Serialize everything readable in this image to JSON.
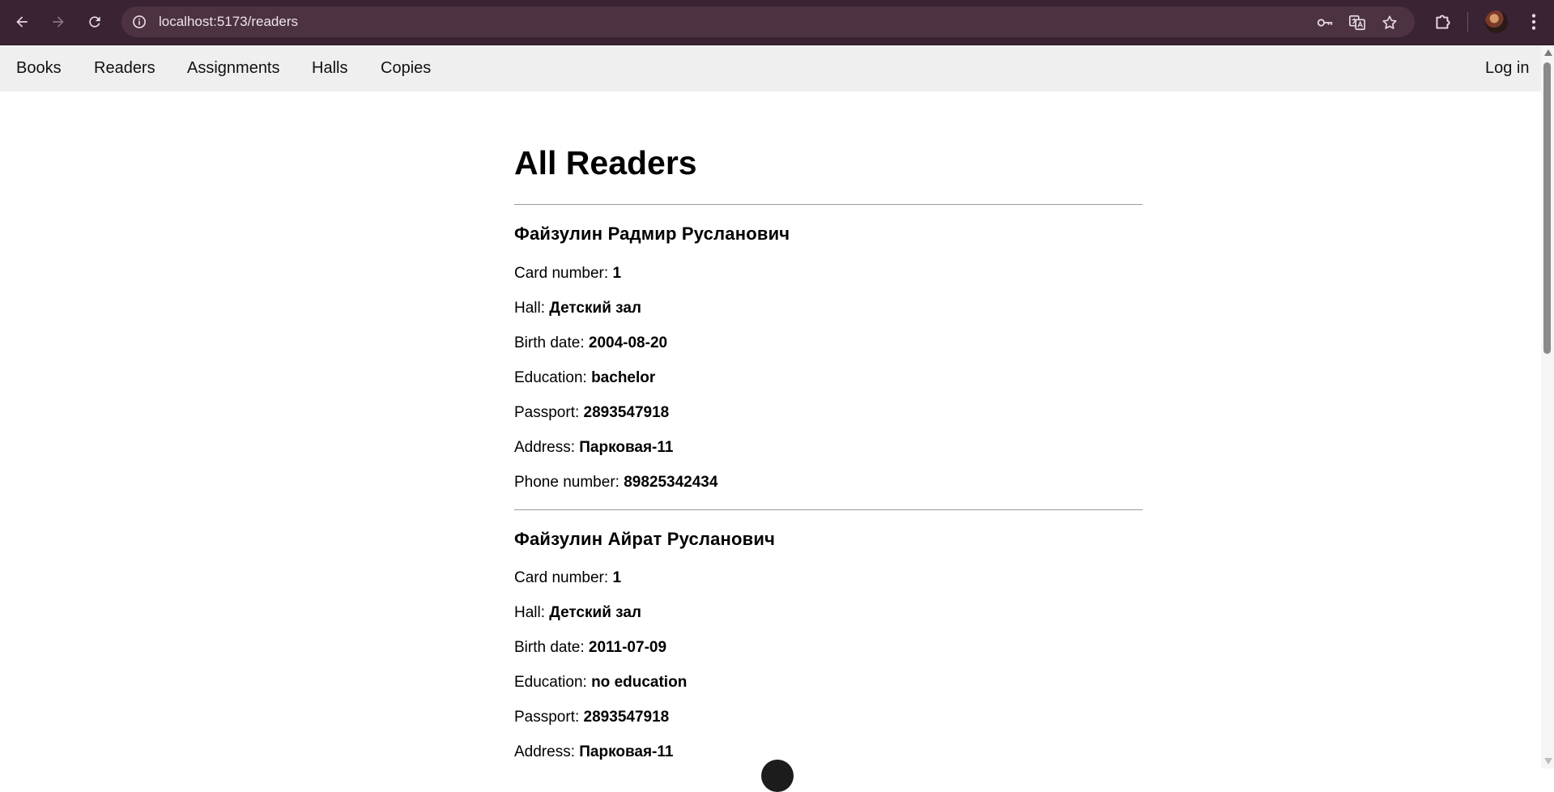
{
  "browser": {
    "url": "localhost:5173/readers",
    "back_icon": "arrow-left-icon",
    "forward_icon": "arrow-right-icon",
    "reload_icon": "reload-icon"
  },
  "nav": {
    "links": [
      "Books",
      "Readers",
      "Assignments",
      "Halls",
      "Copies"
    ],
    "login": "Log in"
  },
  "page": {
    "title": "All Readers"
  },
  "labels": {
    "card": "Card number: ",
    "hall": "Hall: ",
    "birth": "Birth date: ",
    "education": "Education: ",
    "passport": "Passport: ",
    "address": "Address: ",
    "phone": "Phone number: "
  },
  "readers": [
    {
      "name": "Файзулин Радмир Русланович",
      "card_number": "1",
      "hall": "Детский зал",
      "birth_date": "2004-08-20",
      "education": "bachelor",
      "passport": "2893547918",
      "address": "Парковая-11",
      "phone": "89825342434"
    },
    {
      "name": "Файзулин Айрат Русланович",
      "card_number": "1",
      "hall": "Детский зал",
      "birth_date": "2011-07-09",
      "education": "no education",
      "passport": "2893547918",
      "address": "Парковая-11"
    }
  ]
}
